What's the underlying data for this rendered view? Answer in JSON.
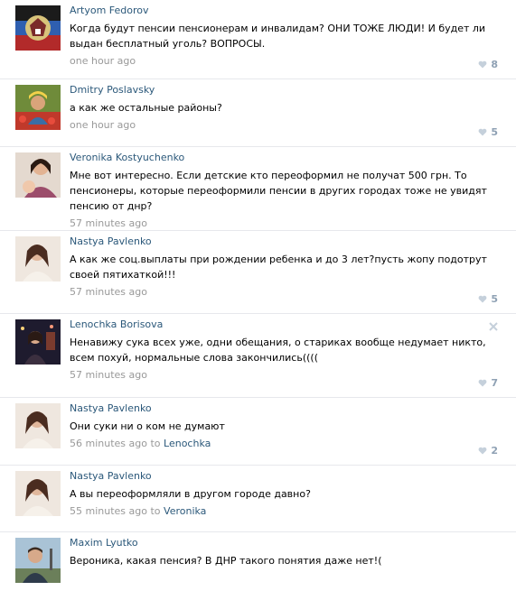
{
  "comments": [
    {
      "author": "Artyom Fedorov",
      "text": "Когда будут пенсии пенсионерам и инвалидам? ОНИ ТОЖЕ ЛЮДИ! И будет ли выдан бесплатный уголь? ВОПРОСЫ.",
      "time": "one hour ago",
      "reply_to": "",
      "likes": "8",
      "avatar_icon": "flag-emblem-avatar"
    },
    {
      "author": "Dmitry Poslavsky",
      "text": "а как же остальные районы?",
      "time": "one hour ago",
      "reply_to": "",
      "likes": "5",
      "avatar_icon": "person-with-flowers-avatar"
    },
    {
      "author": "Veronika Kostyuchenko",
      "text": "Мне вот интересно. Если детские кто переоформил не получат 500 грн. То пенсионеры, которые переоформили пенсии в других городах тоже не увидят пенсию от днр?",
      "time": "57 minutes ago",
      "reply_to": "",
      "likes": "",
      "avatar_icon": "woman-with-child-avatar"
    },
    {
      "author": "Nastya Pavlenko",
      "text": "А как же соц.выплаты при рождении ребенка и до 3 лет?пусть жопу подотрут своей пятихаткой!!!",
      "time": "57 minutes ago",
      "reply_to": "",
      "likes": "5",
      "avatar_icon": "woman-portrait-avatar"
    },
    {
      "author": "Lenochka Borisova",
      "text": "Ненавижу сука всех уже, одни обещания, о стариках вообще недумает никто, всем похуй, нормальные слова закончились((((",
      "time": "57 minutes ago",
      "reply_to": "",
      "likes": "7",
      "avatar_icon": "woman-at-night-avatar"
    },
    {
      "author": "Nastya Pavlenko",
      "text": "Они суки ни о ком не думают",
      "time": "56 minutes ago",
      "reply_to": "Lenochka",
      "likes": "2",
      "avatar_icon": "woman-portrait-avatar"
    },
    {
      "author": "Nastya Pavlenko",
      "text": "А вы переоформляли в другом городе давно?",
      "time": "55 minutes ago",
      "reply_to": "Veronika",
      "likes": "",
      "avatar_icon": "woman-portrait-avatar"
    },
    {
      "author": "Maxim Lyutko",
      "text": "Вероника, какая пенсия? В ДНР такого понятия даже нет!(",
      "time": "",
      "reply_to": "",
      "likes": "",
      "avatar_icon": "man-outdoors-avatar"
    }
  ],
  "labels": {
    "to": "to"
  },
  "colors": {
    "link": "#2b587a",
    "meta": "#999999",
    "like": "#8fa1b4",
    "divider": "#e7e8ec"
  }
}
